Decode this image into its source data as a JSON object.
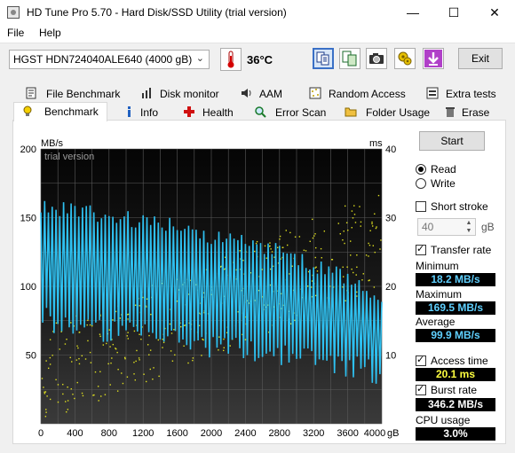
{
  "window": {
    "title": "HD Tune Pro 5.70 - Hard Disk/SSD Utility (trial version)",
    "minimize": "—",
    "maximize": "☐",
    "close": "✕"
  },
  "menu": {
    "file": "File",
    "help": "Help"
  },
  "toolbar": {
    "drive": "HGST HDN724040ALE640 (4000 gB)",
    "temperature": "36°C",
    "exit": "Exit"
  },
  "tabs": {
    "row1": [
      "File Benchmark",
      "Disk monitor",
      "AAM",
      "Random Access",
      "Extra tests"
    ],
    "row2": [
      "Benchmark",
      "Info",
      "Health",
      "Error Scan",
      "Folder Usage",
      "Erase"
    ],
    "selected": "Benchmark"
  },
  "controls": {
    "start": "Start",
    "read": "Read",
    "write": "Write",
    "mode_selected": "Read",
    "short_stroke": "Short stroke",
    "short_stroke_checked": false,
    "short_stroke_value": "40",
    "short_stroke_unit": "gB",
    "transfer_rate": "Transfer rate",
    "transfer_rate_checked": true,
    "access_time": "Access time",
    "access_time_checked": true,
    "burst_rate": "Burst rate",
    "burst_rate_checked": true
  },
  "stats": {
    "minimum_label": "Minimum",
    "minimum": "18.2 MB/s",
    "maximum_label": "Maximum",
    "maximum": "169.5 MB/s",
    "average_label": "Average",
    "average": "99.9 MB/s",
    "access_time": "20.1 ms",
    "burst_rate": "346.2 MB/s",
    "cpu_label": "CPU usage",
    "cpu_usage": "3.0%"
  },
  "chart_data": {
    "type": "line",
    "watermark": "trial version",
    "left_axis_unit": "MB/s",
    "right_axis_unit": "ms",
    "x_unit": "gB",
    "left_ticks": [
      "200",
      "150",
      "100",
      "50"
    ],
    "right_ticks": [
      "40",
      "30",
      "20",
      "10"
    ],
    "x_ticks": [
      "0",
      "400",
      "800",
      "1200",
      "1600",
      "2000",
      "2400",
      "2800",
      "3200",
      "3600",
      "4000"
    ],
    "ylim_left": [
      0,
      200
    ],
    "ylim_right": [
      0,
      40
    ],
    "xlim": [
      0,
      4000
    ],
    "grid": true,
    "series": [
      {
        "name": "Transfer rate",
        "color": "#2ec0f0",
        "upper_envelope": [
          [
            0,
            165
          ],
          [
            400,
            160
          ],
          [
            800,
            158
          ],
          [
            1200,
            153
          ],
          [
            1600,
            149
          ],
          [
            2000,
            142
          ],
          [
            2400,
            138
          ],
          [
            2800,
            133
          ],
          [
            3200,
            122
          ],
          [
            3600,
            112
          ],
          [
            4000,
            96
          ]
        ],
        "lower_envelope": [
          [
            0,
            68
          ],
          [
            400,
            62
          ],
          [
            800,
            58
          ],
          [
            1200,
            55
          ],
          [
            1600,
            52
          ],
          [
            2000,
            48
          ],
          [
            2400,
            45
          ],
          [
            2800,
            42
          ],
          [
            3200,
            38
          ],
          [
            3600,
            34
          ],
          [
            4000,
            28
          ]
        ]
      },
      {
        "name": "Access time",
        "color": "#e0e020",
        "center": [
          [
            0,
            7
          ],
          [
            400,
            9
          ],
          [
            800,
            11
          ],
          [
            1200,
            13
          ],
          [
            1600,
            15
          ],
          [
            2000,
            17
          ],
          [
            2400,
            19
          ],
          [
            2800,
            21
          ],
          [
            3200,
            23
          ],
          [
            3600,
            25
          ],
          [
            4000,
            27
          ]
        ]
      }
    ]
  }
}
